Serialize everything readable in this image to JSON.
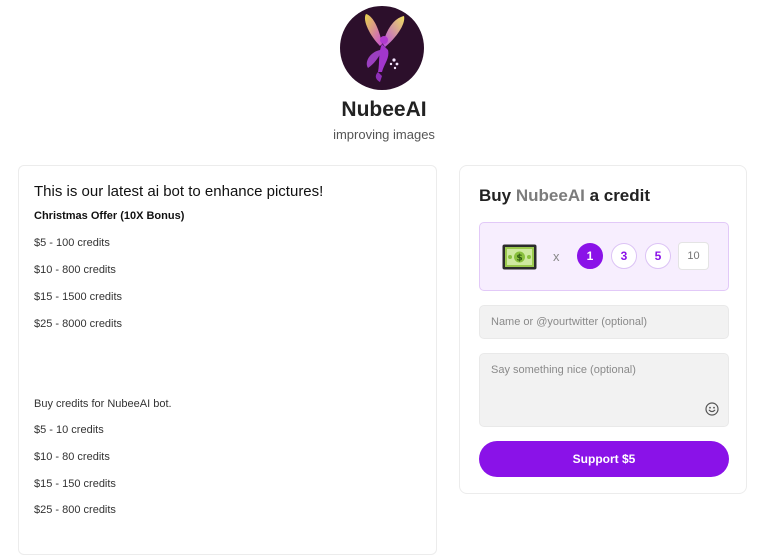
{
  "creator": {
    "name": "NubeeAI",
    "tagline": "improving images",
    "avatar_icon": "fairy-icon"
  },
  "about": {
    "title": "This is our latest ai bot to enhance pictures!",
    "offer_heading": "Christmas Offer (10X Bonus)",
    "offer_items": [
      "$5 - 100 credits",
      "$10 - 800 credits",
      "$15 - 1500 credits",
      "$25 - 8000 credits"
    ],
    "regular_heading": "Buy credits for NubeeAI bot.",
    "regular_items": [
      "$5 - 10 credits",
      "$10 - 80 credits",
      "$15 - 150 credits",
      "$25 - 800 credits"
    ]
  },
  "support": {
    "title_prefix": "Buy",
    "title_name": "NubeeAI",
    "title_suffix": "a credit",
    "item_icon": "money-icon",
    "multiplier": "x",
    "quantity_options": [
      "1",
      "3",
      "5"
    ],
    "selected_quantity": "1",
    "custom_quantity_placeholder": "10",
    "name_placeholder": "Name or @yourtwitter (optional)",
    "message_placeholder": "Say something nice (optional)",
    "emoji_icon": "smiley-icon",
    "button_label": "Support $5",
    "accent_color": "#8a12e8"
  }
}
